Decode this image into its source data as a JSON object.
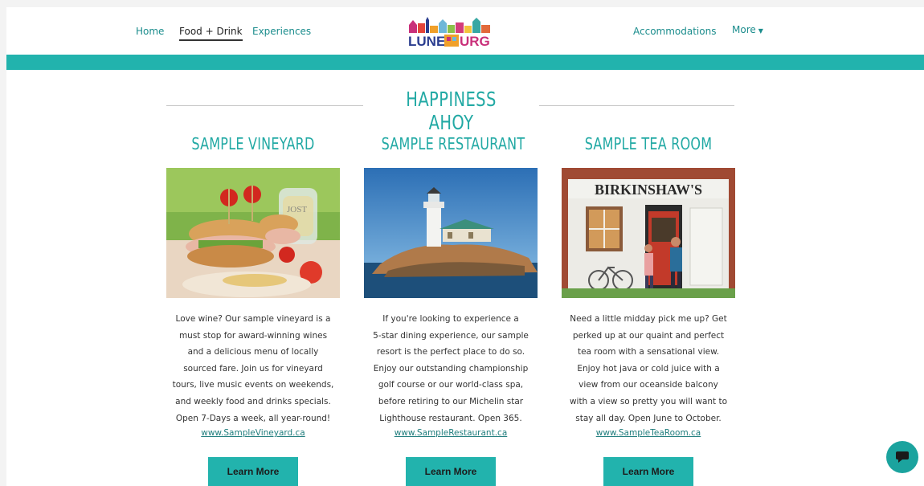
{
  "nav": {
    "home": "Home",
    "food": "Food + Drink",
    "experiences": "Experiences",
    "accommodations": "Accommodations",
    "more": "More",
    "more_icon": "caret-down-icon"
  },
  "logo": {
    "text_left": "LUNE",
    "text_right": "URG"
  },
  "hero": {
    "title": "HAPPINESS AHOY"
  },
  "columns": [
    {
      "title": "SAMPLE VINEYARD",
      "desc": [
        "Love wine? Our sample vineyard is a",
        "must stop for award-winning wines",
        "and a delicious menu of locally",
        "sourced fare. Join us for vineyard",
        "tours, live music events on weekends,",
        "and weekly food and drinks specials.",
        "Open 7-Days a week, all year-round!"
      ],
      "link": "www.SampleVineyard.ca",
      "button": "Learn More",
      "photo_glass_text": "JOST"
    },
    {
      "title": "SAMPLE RESTAURANT",
      "desc": [
        "If you're looking to experience a",
        "5-star dining experience, our sample",
        "resort is the perfect place to do so.",
        "Enjoy our outstanding championship",
        "golf course or our world-class spa,",
        "before retiring to our Michelin star",
        "Lighthouse restaurant. Open 365."
      ],
      "link": "www.SampleRestaurant.ca",
      "button": "Learn More"
    },
    {
      "title": "SAMPLE TEA ROOM",
      "desc": [
        "Need a little midday pick me up? Get",
        "perked up at our quaint and perfect",
        "tea room with a sensational view.",
        "Enjoy hot java or cold juice with a",
        "view from our oceanside balcony",
        "with a view so pretty you will want to",
        "stay all day. Open June to October."
      ],
      "link": "www.SampleTeaRoom.ca",
      "button": "Learn More",
      "photo_sign_text": "BIRKINSHAW'S"
    }
  ],
  "chat": {
    "icon": "chat-bubble-icon"
  },
  "colors": {
    "accent": "#22b3ad",
    "heading": "#22a9a4",
    "link": "#1f7d7d"
  }
}
